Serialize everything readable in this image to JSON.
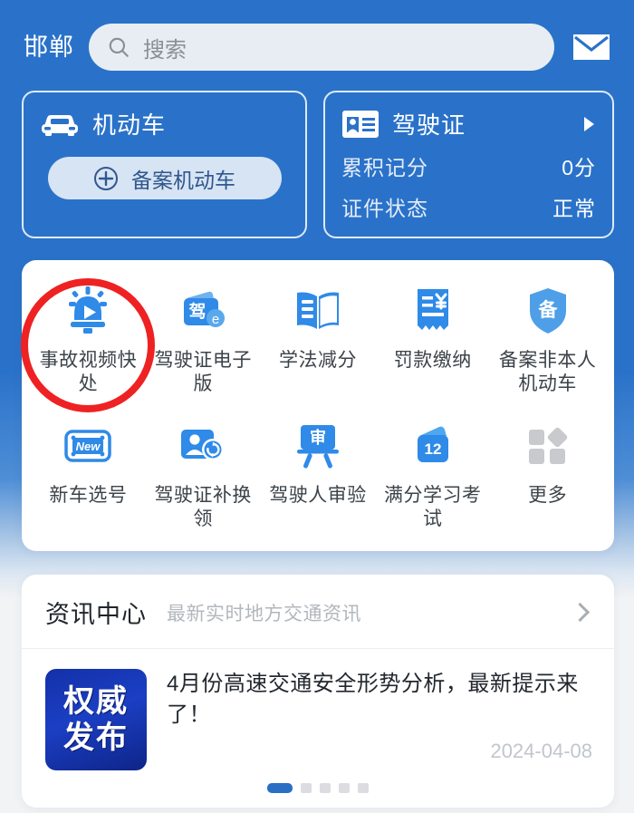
{
  "theme": {
    "brand_blue": "#2a72c9",
    "accent_red": "#ee2222",
    "icon_blue": "#2f8ae8",
    "muted_gray": "#c2c6cb"
  },
  "header": {
    "city": "邯郸",
    "search_placeholder": "搜索",
    "search_icon": "search-icon",
    "mail_icon": "mail-icon"
  },
  "vehicle_card": {
    "title": "机动车",
    "icon": "car-icon",
    "record_button": {
      "label": "备案机动车",
      "icon": "plus-circle-icon"
    }
  },
  "license_card": {
    "title": "驾驶证",
    "icon": "id-card-icon",
    "chevron": "chevron-right-icon",
    "rows": [
      {
        "label": "累积记分",
        "value": "0分"
      },
      {
        "label": "证件状态",
        "value": "正常"
      }
    ]
  },
  "services": {
    "rows": [
      [
        {
          "label": "事故视频快处",
          "icon": "siren-play-icon",
          "highlighted": true
        },
        {
          "label": "驾驶证电子版",
          "icon": "license-wallet-icon",
          "highlighted": false
        },
        {
          "label": "学法减分",
          "icon": "open-book-icon",
          "highlighted": false
        },
        {
          "label": "罚款缴纳",
          "icon": "receipt-yuan-icon",
          "highlighted": false
        },
        {
          "label": "备案非本人机动车",
          "icon": "shield-bei-icon",
          "highlighted": false
        }
      ],
      [
        {
          "label": "新车选号",
          "icon": "new-plate-icon",
          "highlighted": false
        },
        {
          "label": "驾驶证补换领",
          "icon": "person-refresh-icon",
          "highlighted": false
        },
        {
          "label": "驾驶人审验",
          "icon": "board-shen-icon",
          "highlighted": false
        },
        {
          "label": "满分学习考试",
          "icon": "calendar-12-icon",
          "highlighted": false
        },
        {
          "label": "更多",
          "icon": "more-squares-icon",
          "highlighted": false
        }
      ]
    ]
  },
  "news": {
    "title": "资讯中心",
    "subtitle": "最新实时地方交通资讯",
    "chevron": "chevron-right-icon",
    "item": {
      "thumb_line1": "权威",
      "thumb_line2": "发布",
      "headline": "4月份高速交通安全形势分析，最新提示来了！",
      "date": "2024-04-08"
    },
    "pagination": {
      "total": 5,
      "active_index": 0
    }
  }
}
